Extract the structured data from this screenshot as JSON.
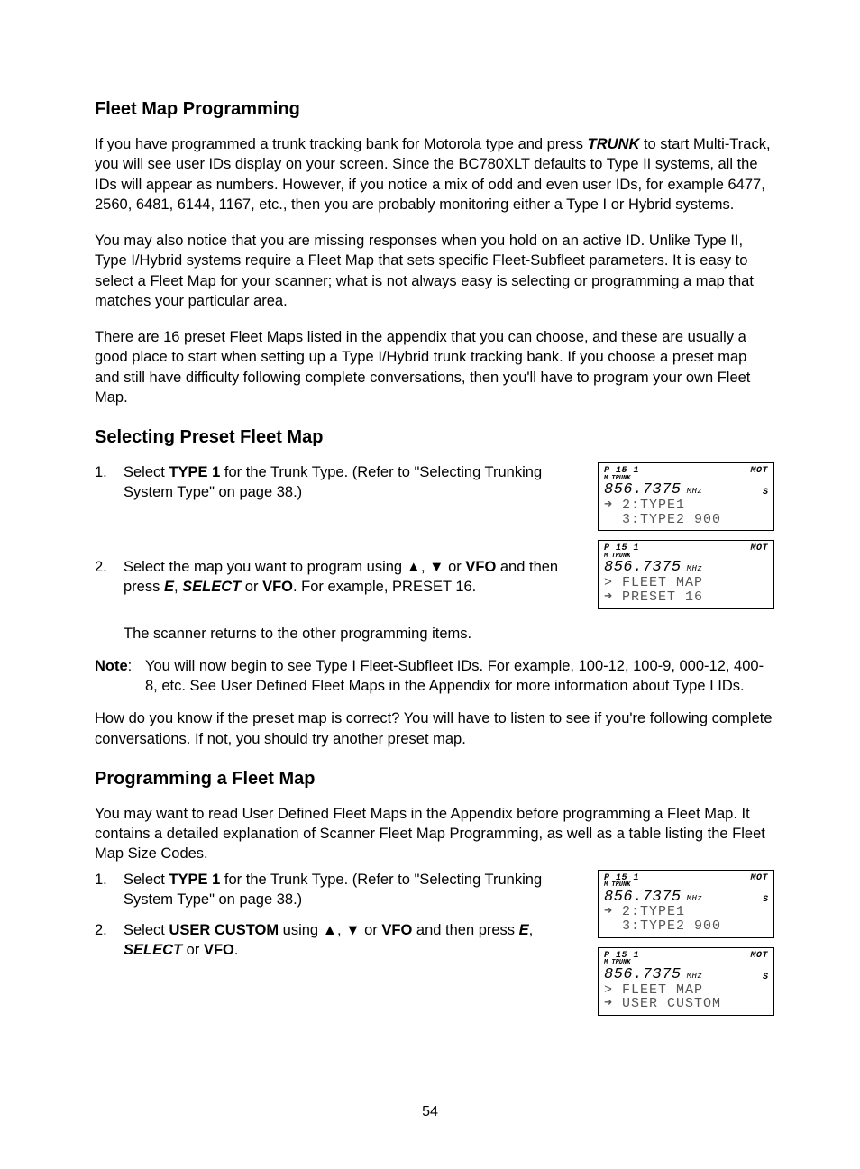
{
  "section1": {
    "heading": "Fleet Map Programming",
    "p1a": "If you have programmed a trunk tracking bank for Motorola type and press ",
    "p1b": "TRUNK",
    "p1c": " to start Multi-Track, you will see user IDs display on your screen. Since the BC780XLT defaults to Type II systems, all the IDs will appear as numbers. However, if you notice a mix of odd and even user IDs, for example 6477, 2560, 6481, 6144, 1167, etc., then you are probably monitoring either a Type I or Hybrid systems.",
    "p2": "You may also notice that you are missing responses when you hold on an active ID. Unlike Type II, Type I/Hybrid systems require a Fleet Map that sets specific Fleet-Subfleet parameters. It is easy to select a Fleet Map for your scanner; what is not always easy is selecting or programming a map that matches your particular area.",
    "p3": "There are 16 preset Fleet Maps listed in the appendix that you can choose, and these are usually a good place to start when setting up a Type I/Hybrid trunk tracking bank. If you choose a preset map and still have difficulty following complete conversations, then you'll have to program your own Fleet Map."
  },
  "section2": {
    "heading": "Selecting Preset Fleet Map",
    "li1_num": "1.",
    "li1a": "Select ",
    "li1b": "TYPE 1",
    "li1c": " for the Trunk Type. (Refer to \"Selecting Trunking System Type\" on page 38.)",
    "li2_num": "2.",
    "li2a": "Select the map you want to program using ",
    "li2_arrows": "▲, ▼",
    "li2b": " or ",
    "li2_vfo1": "VFO",
    "li2c": " and then press ",
    "li2_e": "E",
    "li2d": ", ",
    "li2_select": "SELECT",
    "li2e": " or ",
    "li2_vfo2": "VFO",
    "li2f": ". For example, PRESET 16.",
    "returns": "The scanner returns to the other programming items.",
    "note_label": "Note",
    "note_sep": ":",
    "note_body": "You will now begin to see Type I Fleet-Subfleet IDs. For example, 100-12, 100-9, 000-12, 400-8, etc. See User Defined Fleet Maps in the Appendix for more information about Type I IDs.",
    "p_after": "How do you know if the preset map is correct? You will have to listen to see if you're following complete conversations. If not, you should try another preset map."
  },
  "section3": {
    "heading": "Programming a Fleet Map",
    "p1": "You may want to read User Defined Fleet Maps in the Appendix before programming a Fleet Map. It contains a detailed explanation of Scanner Fleet Map Programming, as well as a table listing the Fleet Map Size Codes.",
    "li1_num": "1.",
    "li1a": "Select ",
    "li1b": "TYPE 1",
    "li1c": " for the Trunk Type. (Refer to \"Selecting Trunking System Type\" on page 38.)",
    "li2_num": "2.",
    "li2a": "Select ",
    "li2b": "USER CUSTOM",
    "li2c": " using ",
    "li2_arrows": "▲, ▼",
    "li2d": " or ",
    "li2_vfo1": "VFO",
    "li2e": " and then press ",
    "li2_e": "E",
    "li2f": ", ",
    "li2_select": "SELECT",
    "li2g": " or ",
    "li2_vfo2": "VFO",
    "li2h": "."
  },
  "lcd1": {
    "top_left": "P  15 1",
    "top_right": "MOT",
    "sub": "M   TRUNK",
    "freq": "856.7375",
    "freq_unit": "MHz",
    "s": "S",
    "row1": "➜ 2:TYPE1",
    "row2": "  3:TYPE2 900"
  },
  "lcd2": {
    "top_left": "P  15 1",
    "top_right": "MOT",
    "sub": "M   TRUNK",
    "freq": "856.7375",
    "freq_unit": "MHz",
    "row1": "> FLEET MAP",
    "row2": "➜ PRESET 16"
  },
  "lcd3": {
    "top_left": "P  15 1",
    "top_right": "MOT",
    "sub": "M   TRUNK",
    "freq": "856.7375",
    "freq_unit": "MHz",
    "s": "S",
    "row1": "➜ 2:TYPE1",
    "row2": "  3:TYPE2 900"
  },
  "lcd4": {
    "top_left": "P  15 1",
    "top_right": "MOT",
    "sub": "M   TRUNK",
    "freq": "856.7375",
    "freq_unit": "MHz",
    "s": "S",
    "row1": "> FLEET MAP",
    "row2": "➜ USER CUSTOM"
  },
  "page_number": "54"
}
